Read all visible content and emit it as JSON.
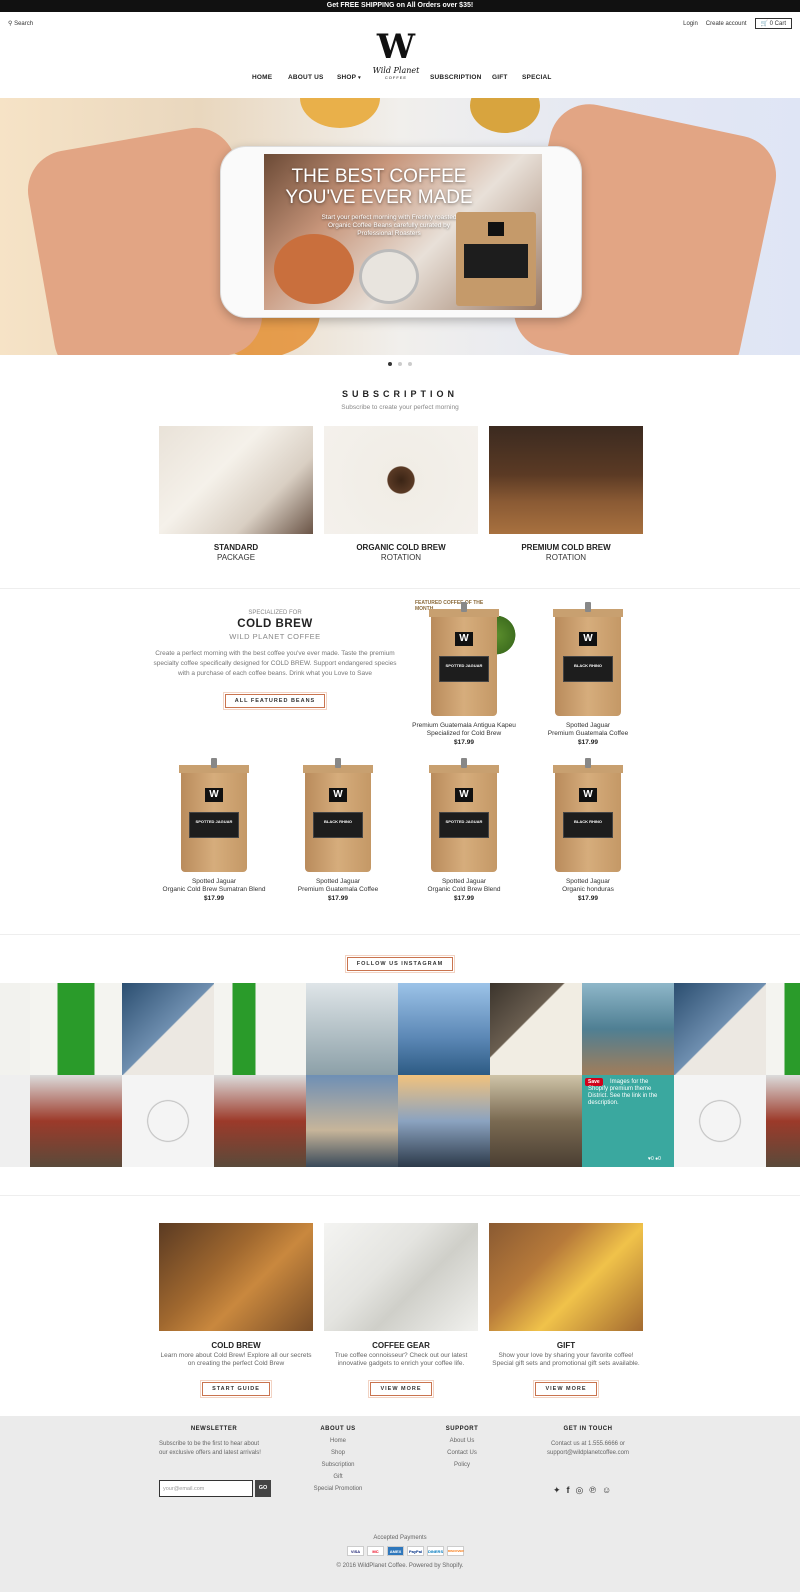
{
  "promo": "Get FREE SHIPPING on All Orders over $35!",
  "header": {
    "search": "Search",
    "login": "Login",
    "create_account": "Create account",
    "cart": "0 Cart",
    "logo_letter": "W",
    "logo_name": "Wild Planet",
    "logo_sub": "COFFEE",
    "nav": [
      "HOME",
      "ABOUT US",
      "SHOP",
      "SUBSCRIPTION",
      "GIFT",
      "SPECIAL"
    ]
  },
  "hero": {
    "title_line1": "THE BEST COFFEE",
    "title_line2": "YOU'VE EVER MADE",
    "subtitle": "Start your perfect morning with Freshly roasted Organic Coffee Beans carefully curated by Professional Roasters",
    "slides": 3,
    "active_slide": 1
  },
  "subscription": {
    "title": "SUBSCRIPTION",
    "subtitle": "Subscribe to create your perfect morning",
    "cards": [
      {
        "title": "STANDARD",
        "sub": "PACKAGE"
      },
      {
        "title": "ORGANIC COLD BREW",
        "sub": "ROTATION"
      },
      {
        "title": "PREMIUM COLD BREW",
        "sub": "ROTATION"
      }
    ]
  },
  "coldbrew": {
    "kicker": "SPECIALIZED FOR",
    "title": "COLD BREW",
    "subtitle": "WILD PLANET COFFEE",
    "desc": "Create a perfect morning with the best coffee you've ever made. Taste the premium specialty coffee specifically designed for COLD BREW. Support endangered species with a purchase of each coffee beans. Drink what you Love to Save",
    "button": "ALL FEATURED BEANS",
    "featured_tag": "FEATURED COFFEE OF THE MONTH"
  },
  "products": [
    {
      "line1": "Premium Guatemala Antigua Kapeu",
      "line2": "Specialized for Cold Brew",
      "price": "$17.99",
      "label": "SPOTTED JAGUAR"
    },
    {
      "line1": "Spotted Jaguar",
      "line2": "Premium Guatemala Coffee",
      "price": "$17.99",
      "label": "BLACK RHINO"
    },
    {
      "line1": "Spotted Jaguar",
      "line2": "Organic Cold Brew Sumatran Blend",
      "price": "$17.99",
      "label": "SPOTTED JAGUAR"
    },
    {
      "line1": "Spotted Jaguar",
      "line2": "Premium Guatemala Coffee",
      "price": "$17.99",
      "label": "BLACK RHINO"
    },
    {
      "line1": "Spotted Jaguar",
      "line2": "Organic Cold Brew Blend",
      "price": "$17.99",
      "label": "SPOTTED JAGUAR"
    },
    {
      "line1": "Spotted Jaguar",
      "line2": "Organic honduras",
      "price": "$17.99",
      "label": "BLACK RHINO"
    }
  ],
  "instagram": {
    "button": "FOLLOW US INSTAGRAM",
    "overlay_save": "Save",
    "overlay_text": "Images for the Shopify premium theme District. See the link in the description.",
    "likes": "0",
    "comments": "0"
  },
  "bottom_cards": [
    {
      "title": "COLD BREW",
      "desc": "Learn more about Cold Brew! Explore all our secrets on creating the perfect Cold Brew",
      "button": "START GUIDE"
    },
    {
      "title": "COFFEE GEAR",
      "desc": "True coffee connoisseur? Check out our latest innovative gadgets to enrich your coffee life.",
      "button": "VIEW MORE"
    },
    {
      "title": "GIFT",
      "desc": "Show your love by sharing your favorite coffee! Special gift sets and promotional gift sets available.",
      "button": "VIEW MORE"
    }
  ],
  "footer": {
    "newsletter_title": "NEWSLETTER",
    "newsletter_text": "Subscribe to be the first to hear about our exclusive offers and latest arrivals!",
    "email_placeholder": "your@email.com",
    "go": "GO",
    "about_title": "ABOUT US",
    "about_links": [
      "Home",
      "Shop",
      "Subscription",
      "Gift",
      "Special Promotion"
    ],
    "support_title": "SUPPORT",
    "support_links": [
      "About Us",
      "Contact Us",
      "Policy"
    ],
    "contact_title": "GET IN TOUCH",
    "contact_phone": "Contact us at 1.555.6666 or",
    "contact_email": "support@wildplanetcoffee.com",
    "social_icons": [
      "twitter-icon",
      "facebook-icon",
      "instagram-icon",
      "pinterest-icon",
      "snapchat-icon"
    ],
    "payments_title": "Accepted Payments",
    "payments": [
      "VISA",
      "MC",
      "AMEX",
      "PayPal",
      "DINERS",
      "DISCOVER"
    ],
    "copyright": "© 2016 WildPlanet Coffee. Powered by Shopify."
  }
}
